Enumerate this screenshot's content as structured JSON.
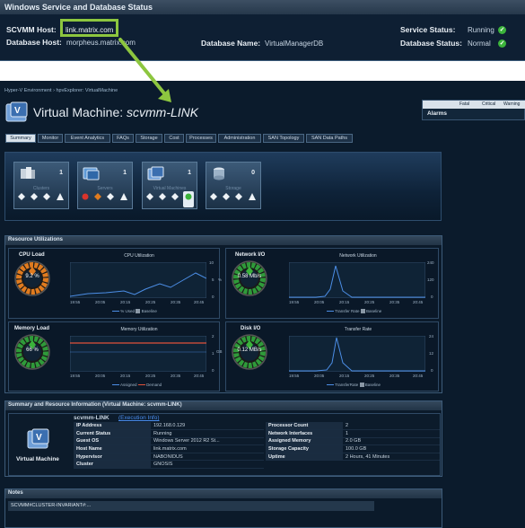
{
  "status_bar": {
    "title": "Windows Service and Database Status",
    "scvmm_host_label": "SCVMM Host:",
    "scvmm_host_value": "link.matrix.com",
    "db_host_label": "Database Host:",
    "db_host_value": "morpheus.matrix.com",
    "db_name_label": "Database Name:",
    "db_name_value": "VirtualManagerDB",
    "service_status_label": "Service Status:",
    "service_status_value": "Running",
    "database_status_label": "Database Status:",
    "database_status_value": "Normal",
    "ok_icon": "check-circle-icon",
    "ok_color": "#3bb33b",
    "highlight_color": "#8dc63f"
  },
  "breadcrumb": [
    "Hyper-V Environment",
    "hpvExplorer: VirtualMachine"
  ],
  "page": {
    "title_prefix": "Virtual Machine: ",
    "title_name": "scvmm-LINK",
    "icon": "virtual-machine-icon"
  },
  "alarms": {
    "label": "Alarms",
    "columns": [
      "Fatal",
      "Critical",
      "Warning"
    ]
  },
  "tabs": [
    "Summary",
    "Monitor",
    "Event Analytics",
    "FAQs",
    "Storage",
    "Cost",
    "Processes",
    "Administration",
    "SAN Topology",
    "SAN Data Paths"
  ],
  "active_tab": "Summary",
  "topology": [
    {
      "label": "Clusters",
      "count": "1",
      "icon": "cluster-icon"
    },
    {
      "label": "Servers",
      "count": "1",
      "icon": "server-icon"
    },
    {
      "label": "Virtual Machines",
      "count": "1",
      "icon": "virtual-machine-icon"
    },
    {
      "label": "Storage",
      "count": "0",
      "icon": "storage-icon"
    }
  ],
  "resource": {
    "title": "Resource Utilizations",
    "cpu": {
      "gauge_label": "CPU Load",
      "gauge_value": "9.2 %",
      "gauge_fraction": 0.092,
      "chart_title": "CPU Utilization",
      "x_ticks": [
        "19:55",
        "20:05",
        "20:15",
        "20:25",
        "20:35",
        "20:45"
      ],
      "y_ticks": [
        "10",
        "5",
        "0"
      ],
      "y_unit": "%",
      "legend": [
        "% Used",
        "Baseline"
      ]
    },
    "network": {
      "gauge_label": "Network I/O",
      "gauge_value": "0.58 Mb/s",
      "gauge_fraction": 0.05,
      "chart_title": "Network Utilization",
      "x_ticks": [
        "19:55",
        "20:05",
        "20:15",
        "20:25",
        "20:35",
        "20:45"
      ],
      "y_ticks": [
        "240",
        "120",
        "0"
      ],
      "y_unit": "Mb/s",
      "legend": [
        "Transfer Rate",
        "Baseline"
      ]
    },
    "memory": {
      "gauge_label": "Memory Load",
      "gauge_value": "66 %",
      "gauge_fraction": 0.66,
      "chart_title": "Memory Utilization",
      "x_ticks": [
        "19:55",
        "20:05",
        "20:15",
        "20:25",
        "20:35",
        "20:45"
      ],
      "y_ticks": [
        "2",
        "1",
        "0"
      ],
      "y_unit": "GB",
      "legend": [
        "Assigned",
        "Demand"
      ]
    },
    "disk": {
      "gauge_label": "Disk I/O",
      "gauge_value": "0.12 MB/s",
      "gauge_fraction": 0.04,
      "chart_title": "Transfer Rate",
      "x_ticks": [
        "19:55",
        "20:05",
        "20:15",
        "20:25",
        "20:35",
        "20:45"
      ],
      "y_ticks": [
        "24",
        "12",
        "0"
      ],
      "y_unit": "MB/s",
      "legend": [
        "TransferRate",
        "Baseline"
      ]
    }
  },
  "summary": {
    "title": "Summary and Resource Information (Virtual Machine: scvmm-LINK)",
    "vm_label": "Virtual Machine",
    "name": "scvmm-LINK",
    "link": "(Execution Info)",
    "left": [
      {
        "k": "IP Address",
        "v": "192.168.0.129"
      },
      {
        "k": "Current Status",
        "v": "Running"
      },
      {
        "k": "Guest OS",
        "v": "Windows Server 2012 R2 St..."
      },
      {
        "k": "Host Name",
        "v": "link.matrix.com"
      },
      {
        "k": "Hypervisor",
        "v": "NABONIDUS"
      },
      {
        "k": "Cluster",
        "v": "GNOSIS"
      }
    ],
    "right": [
      {
        "k": "Processor Count",
        "v": "2"
      },
      {
        "k": "Network Interfaces",
        "v": "1"
      },
      {
        "k": "Assigned Memory",
        "v": "2.0 GB"
      },
      {
        "k": "Storage Capacity",
        "v": "100.0 GB"
      },
      {
        "k": "Uptime",
        "v": "2 Hours, 41 Minutes"
      }
    ]
  },
  "notes": {
    "title": "Notes",
    "text": "SCVMM#CLUSTER-INVARIANT#:..."
  }
}
